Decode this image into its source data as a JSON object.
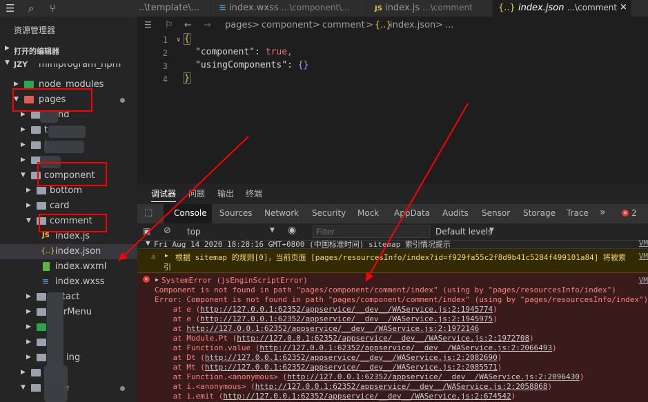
{
  "sidebar": {
    "title": "资源管理器",
    "open_editors": "打开的编辑器",
    "root": "JZY",
    "items": [
      {
        "label": "miniprogram_npm"
      },
      {
        "label": "node_modules"
      },
      {
        "label": "pages"
      },
      {
        "label": "nd"
      },
      {
        "label": "t"
      },
      {
        "label": "b"
      },
      {
        "label": ""
      },
      {
        "label": "component"
      },
      {
        "label": "bottom"
      },
      {
        "label": "card"
      },
      {
        "label": "comment"
      },
      {
        "label": "index.js"
      },
      {
        "label": "index.json"
      },
      {
        "label": "index.wxml"
      },
      {
        "label": "index.wxss"
      },
      {
        "label": "tact"
      },
      {
        "label": "rMenu"
      },
      {
        "label": ""
      },
      {
        "label": ""
      },
      {
        "label": "ing"
      },
      {
        "label": "d"
      },
      {
        "label": "e"
      }
    ]
  },
  "tabs": [
    {
      "label": "..\\template\\...",
      "desc": ""
    },
    {
      "label": "index.wxss",
      "desc": "...\\component\\..."
    },
    {
      "label": "index.js",
      "desc": "...\\comment"
    },
    {
      "label": "index.json",
      "desc": "...\\comment"
    }
  ],
  "breadcrumb": [
    "pages",
    ">",
    "component",
    ">",
    "comment",
    ">",
    "{..}",
    "index.json",
    ">",
    "..."
  ],
  "editor": {
    "line_numbers": [
      "1",
      "2",
      "3",
      "4"
    ],
    "lines": [
      {
        "t1": "{",
        "t2": "",
        "t3": ""
      },
      {
        "t1": "\"component\"",
        "t2": ": ",
        "t3": "true,"
      },
      {
        "t1": "\"usingComponents\"",
        "t2": ": ",
        "t3": "{}"
      },
      {
        "t1": "}",
        "t2": "",
        "t3": ""
      }
    ]
  },
  "devtools": {
    "panel_tabs": [
      "调试器",
      "问题",
      "输出",
      "终端"
    ],
    "console_tabs": [
      "Console",
      "Sources",
      "Network",
      "Security",
      "Mock",
      "AppData",
      "Audits",
      "Sensor",
      "Storage",
      "Trace"
    ],
    "more": "»",
    "error_count": "2",
    "context": "top",
    "filter_placeholder": "Filter",
    "levels": "Default levels",
    "log_header": "Fri Aug 14 2020 18:28:16 GMT+0800 (中国标准时间) sitemap 索引情况提示",
    "warn_line1": "根据 sitemap 的规则[0]，当前页面 [pages/resourcesInfo/index?id=f929fa55c2f8d9b41c5284f499101a84] 将被索",
    "warn_line2": "引",
    "vm_label": "VM",
    "error_title": "SystemError (jsEnginScriptError)",
    "error_msg1": "Component is not found in path \"pages/component/comment/index\" (using by \"pages/resourcesInfo/index\")",
    "error_msg2": "Error: Component is not found in path \"pages/component/comment/index\" (using by \"pages/resourcesInfo/index\")",
    "stack": [
      {
        "pre": "    at e (",
        "link": "http://127.0.0.1:62352/appservice/__dev__/WAService.js:2:1945774",
        "post": ")"
      },
      {
        "pre": "    at e (",
        "link": "http://127.0.0.1:62352/appservice/__dev__/WAService.js:2:1945975",
        "post": ")"
      },
      {
        "pre": "    at ",
        "link": "http://127.0.0.1:62352/appservice/__dev__/WAService.js:2:1972146",
        "post": ""
      },
      {
        "pre": "    at Module.Pt (",
        "link": "http://127.0.0.1:62352/appservice/__dev__/WAService.js:2:1972708",
        "post": ")"
      },
      {
        "pre": "    at Function.value (",
        "link": "http://127.0.0.1:62352/appservice/__dev__/WAService.js:2:2066493",
        "post": ")"
      },
      {
        "pre": "    at Dt (",
        "link": "http://127.0.0.1:62352/appservice/__dev__/WAService.js:2:2082690",
        "post": ")"
      },
      {
        "pre": "    at Mt (",
        "link": "http://127.0.0.1:62352/appservice/__dev__/WAService.js:2:2085571",
        "post": ")"
      },
      {
        "pre": "    at Function.<anonymous> (",
        "link": "http://127.0.0.1:62352/appservice/__dev__/WAService.js:2:2096430",
        "post": ")"
      },
      {
        "pre": "    at i.<anonymous> (",
        "link": "http://127.0.0.1:62352/appservice/__dev__/WAService.js:2:2058868",
        "post": ")"
      },
      {
        "pre": "    at i.emit (",
        "link": "http://127.0.0.1:62352/appservice/__dev__/WAService.js:2:674542",
        "post": ")"
      }
    ]
  },
  "colors": {
    "accent": "#007acc",
    "error_bg": "#3a1b1b",
    "warn_bg": "#332b00",
    "annotation": "#ff0000"
  }
}
